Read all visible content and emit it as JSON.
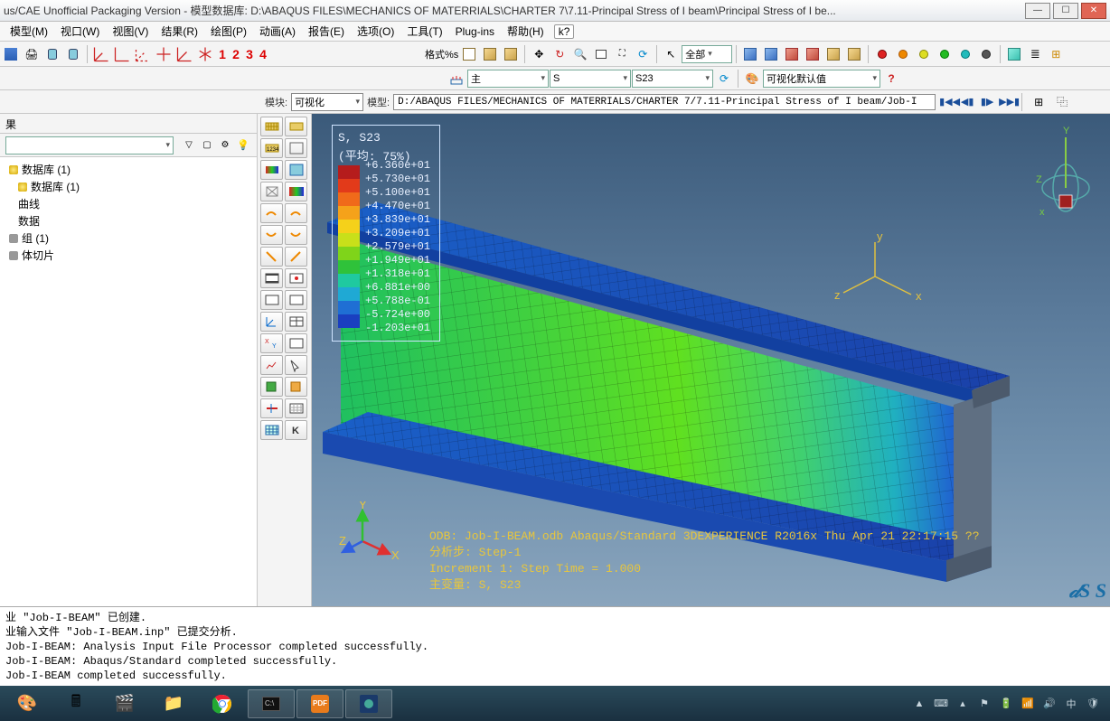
{
  "title": "us/CAE Unofficial Packaging Version - 模型数据库: D:\\ABAQUS FILES\\MECHANICS OF MATERRIALS\\CHARTER 7\\7.11-Principal Stress of I beam\\Principal Stress of I be...",
  "menu": [
    "模型(M)",
    "视口(W)",
    "视图(V)",
    "结果(R)",
    "绘图(P)",
    "动画(A)",
    "报告(E)",
    "选项(O)",
    "工具(T)",
    "Plug-ins",
    "帮助(H)"
  ],
  "tbnums": [
    "1",
    "2",
    "3",
    "4"
  ],
  "toolbar2": {
    "label_fmt": "格式%s",
    "button_all": "全部",
    "vis_label": "可视化默认值"
  },
  "combo_main": "主",
  "combo_s": "S",
  "combo_s23": "S23",
  "context": {
    "module_lbl": "模块:",
    "module_val": "可视化",
    "model_lbl": "模型:",
    "model_path": "D:/ABAQUS FILES/MECHANICS OF MATERRIALS/CHARTER 7/7.11-Principal Stress of I beam/Job-I"
  },
  "tree": {
    "root": "果",
    "items": [
      "数据库 (1)",
      "数据库 (1)",
      "曲线",
      "数据",
      "组 (1)",
      "体切片"
    ]
  },
  "legend": {
    "hdr1": "S, S23",
    "hdr2": "(平均: 75%)",
    "values": [
      "+6.360e+01",
      "+5.730e+01",
      "+5.100e+01",
      "+4.470e+01",
      "+3.839e+01",
      "+3.209e+01",
      "+2.579e+01",
      "+1.949e+01",
      "+1.318e+01",
      "+6.881e+00",
      "+5.788e-01",
      "-5.724e+00",
      "-1.203e+01"
    ],
    "colors": [
      "#b51c1c",
      "#e23a1a",
      "#f06a1a",
      "#f5a21a",
      "#f5d11a",
      "#c8e01a",
      "#7fd41a",
      "#2fc23a",
      "#1fc9a0",
      "#1fa9d4",
      "#1f6fd4",
      "#1a3fc0"
    ]
  },
  "triad": {
    "x": "X",
    "y": "Y",
    "z": "Z",
    "littlex": "x",
    "littley": "y",
    "littlez": "z"
  },
  "vpinfo": {
    "l1": "ODB: Job-I-BEAM.odb    Abaqus/Standard 3DEXPERIENCE R2016x    Thu Apr 21 22:17:15 ??",
    "l2": "分析步: Step-1",
    "l3": "Increment     1: Step Time =   1.000",
    "l4": "主变量: S, S23"
  },
  "dslogo": "𝒹S S",
  "msgs": [
    "业 \"Job-I-BEAM\" 已创建.",
    "业输入文件 \"Job-I-BEAM.inp\" 已提交分析.",
    "Job-I-BEAM: Analysis Input File Processor completed successfully.",
    "Job-I-BEAM: Abaqus/Standard completed successfully.",
    "Job-I-BEAM completed successfully."
  ],
  "tray": {
    "lang": "中",
    "arrow": "▲"
  }
}
